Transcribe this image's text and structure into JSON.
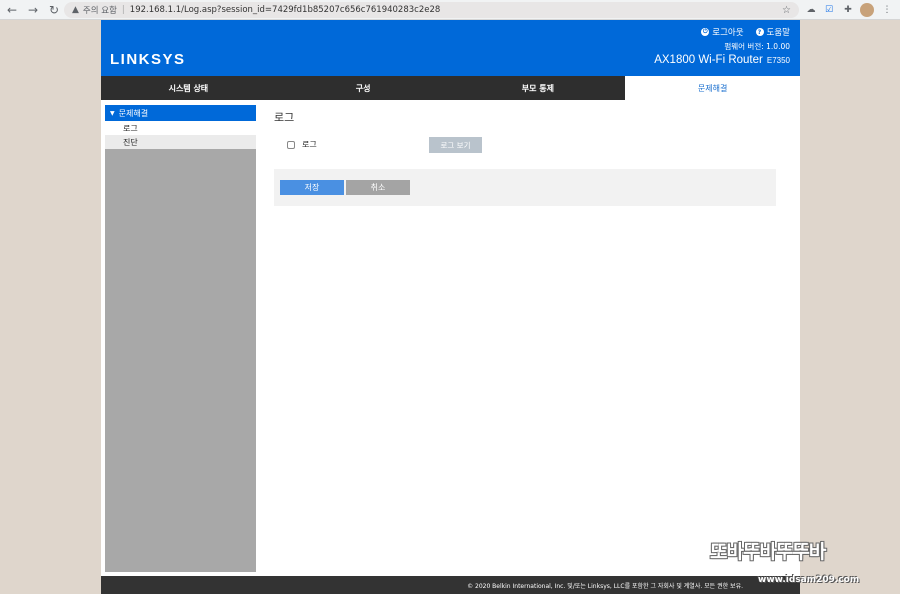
{
  "browser": {
    "security_text": "주의 요함",
    "url": "192.168.1.1/Log.asp?session_id=7429fd1b85207c656c761940283c2e28"
  },
  "header": {
    "logo": "LINKSYS",
    "logout": "로그아웃",
    "help": "도움말",
    "firmware_label": "펌웨어 버전: 1.0.00",
    "model": "AX1800 Wi-Fi Router",
    "model_code": "E7350"
  },
  "tabs": [
    {
      "label": "시스템 상태"
    },
    {
      "label": "구성"
    },
    {
      "label": "부모 통제"
    },
    {
      "label": "문제해결",
      "active": true
    }
  ],
  "sidebar": {
    "section": "문제해결",
    "items": [
      {
        "label": "로그",
        "selected": true
      },
      {
        "label": "진단"
      }
    ]
  },
  "content": {
    "title": "로그",
    "checkbox_label": "로그",
    "checkbox_checked": false,
    "view_log_button": "로그 보기",
    "save_button": "저장",
    "cancel_button": "취소"
  },
  "footer": {
    "text": "© 2020 Belkin International, Inc. 및/또는 Linksys, LLC를 포함한 그 자회사 및 계열사. 모든 권한 보유."
  },
  "watermark": {
    "text": "또바뚜바뚜뚜바",
    "url": "www.idsam209.com"
  },
  "colors": {
    "brand_blue": "#0069d9",
    "nav_dark": "#2e2e2e",
    "sidebar_gray": "#a8a8a8"
  }
}
